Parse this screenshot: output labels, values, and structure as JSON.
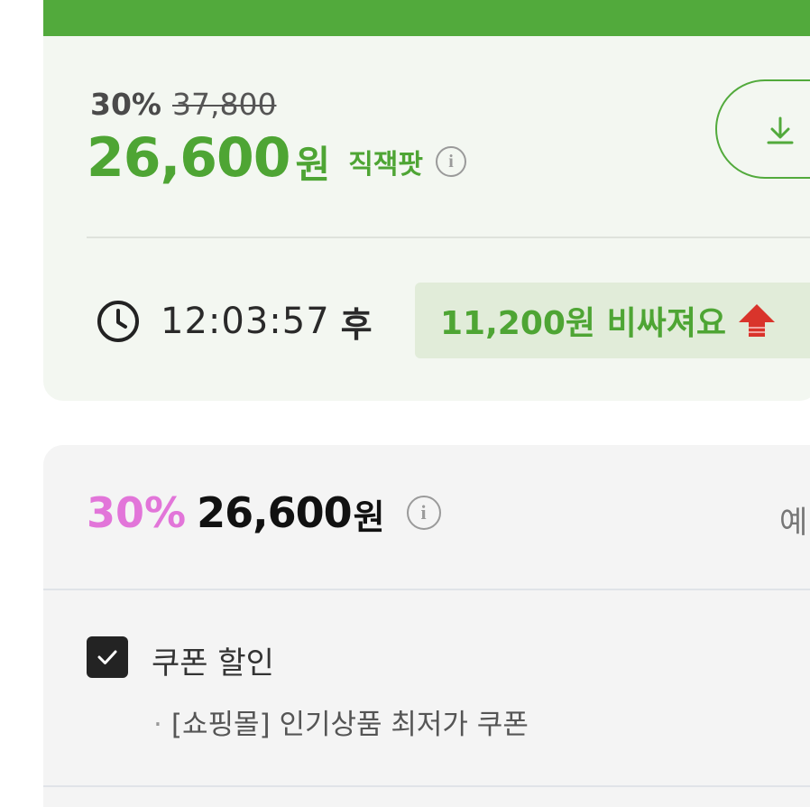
{
  "price_block": {
    "discount_rate": "30%",
    "original_price": "37,800",
    "sale_price": "26,600",
    "currency_unit": "원",
    "badge_label": "직잭팟",
    "timer": "12:03:57",
    "timer_suffix": "후",
    "price_increase_text": "11,200원 비싸져요"
  },
  "coupon_block": {
    "discount_rate": "30%",
    "price": "26,600",
    "currency_unit": "원",
    "right_label": "예",
    "checkbox_checked": true,
    "coupon_label": "쿠폰 할인",
    "coupon_detail": "[쇼핑몰] 인기상품 최저가 쿠폰"
  },
  "icons": {
    "info": "info-icon",
    "download": "download-icon",
    "clock": "clock-icon",
    "arrow_up": "arrow-up-icon",
    "check": "check-icon"
  },
  "colors": {
    "brand_green": "#52aa3c",
    "card_bg": "#f3f7f1",
    "badge_bg": "#e1ecd9",
    "pink_discount": "#e275d9",
    "arrow_red": "#d9342b"
  }
}
